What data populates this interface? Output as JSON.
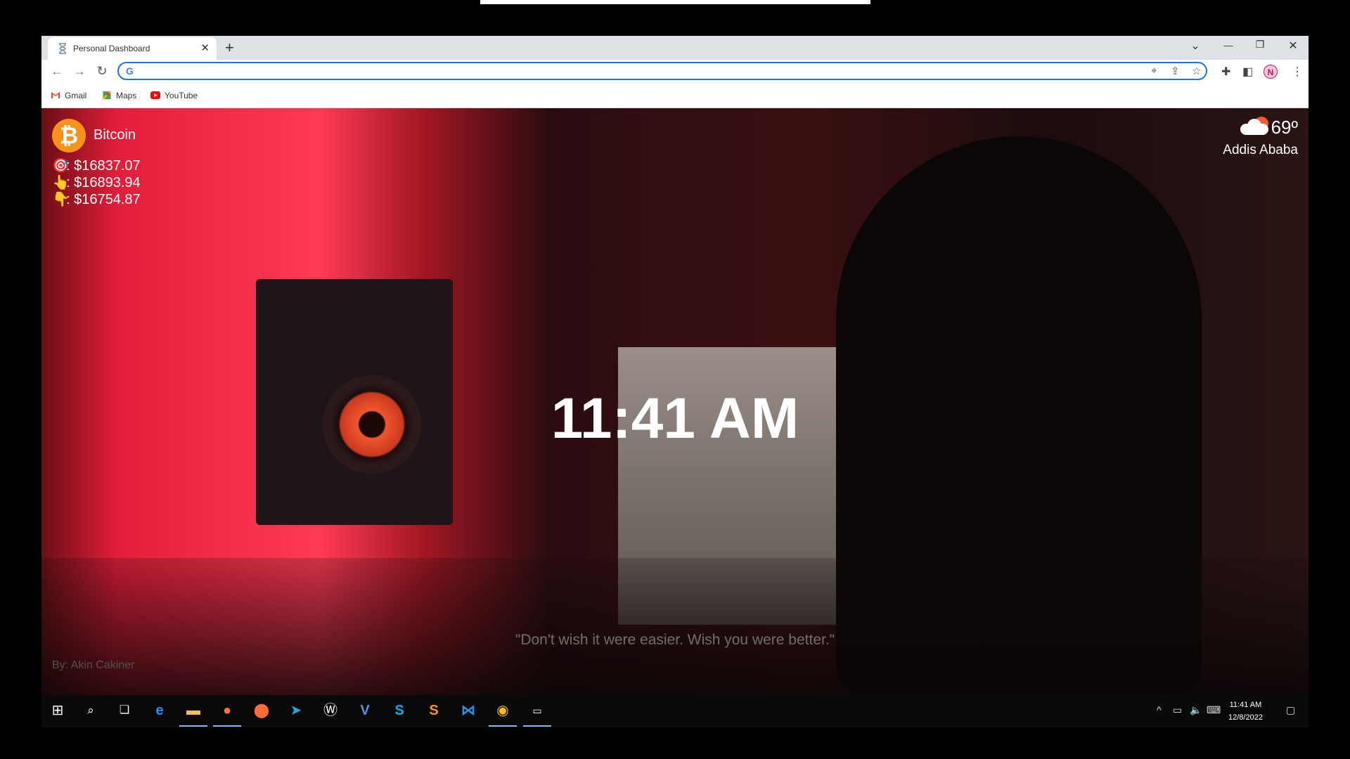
{
  "browser": {
    "tab_title": "Personal Dashboard",
    "new_tab": "+",
    "tab_close": "✕",
    "window_controls": {
      "tab_search": "⌄",
      "minimize": "—",
      "restore": "❐",
      "close": "✕"
    },
    "address_value": "",
    "bookmarks": [
      {
        "label": "Gmail",
        "icon": "gmail-icon"
      },
      {
        "label": "Maps",
        "icon": "maps-icon"
      },
      {
        "label": "YouTube",
        "icon": "youtube-icon"
      }
    ],
    "profile_initial": "N"
  },
  "dashboard": {
    "crypto": {
      "name": "Bitcoin",
      "symbol": "₿",
      "current": ": $16837.07",
      "high": ": $16893.94",
      "low": ": $16754.87"
    },
    "weather": {
      "temp": "69º",
      "city": "Addis Ababa",
      "icon": "partly-cloudy-icon"
    },
    "time": "11:41 AM",
    "quote": "\"Don't wish it were easier. Wish you were better.\"",
    "author": "By: Akin Cakiner"
  },
  "taskbar": {
    "time": "11:41 AM",
    "date": "12/8/2022",
    "apps": [
      "start-icon",
      "search-icon",
      "task-view-icon",
      "edge-icon",
      "file-explorer-icon",
      "firefox-icon",
      "postman-icon",
      "telegram-icon",
      "app-w-icon",
      "vscode-v-icon",
      "skype-icon",
      "sublime-icon",
      "vscode-icon",
      "chrome-icon",
      "terminal-icon"
    ]
  },
  "colors": {
    "accent": "#1a73e8",
    "bitcoin": "#f7931a"
  }
}
